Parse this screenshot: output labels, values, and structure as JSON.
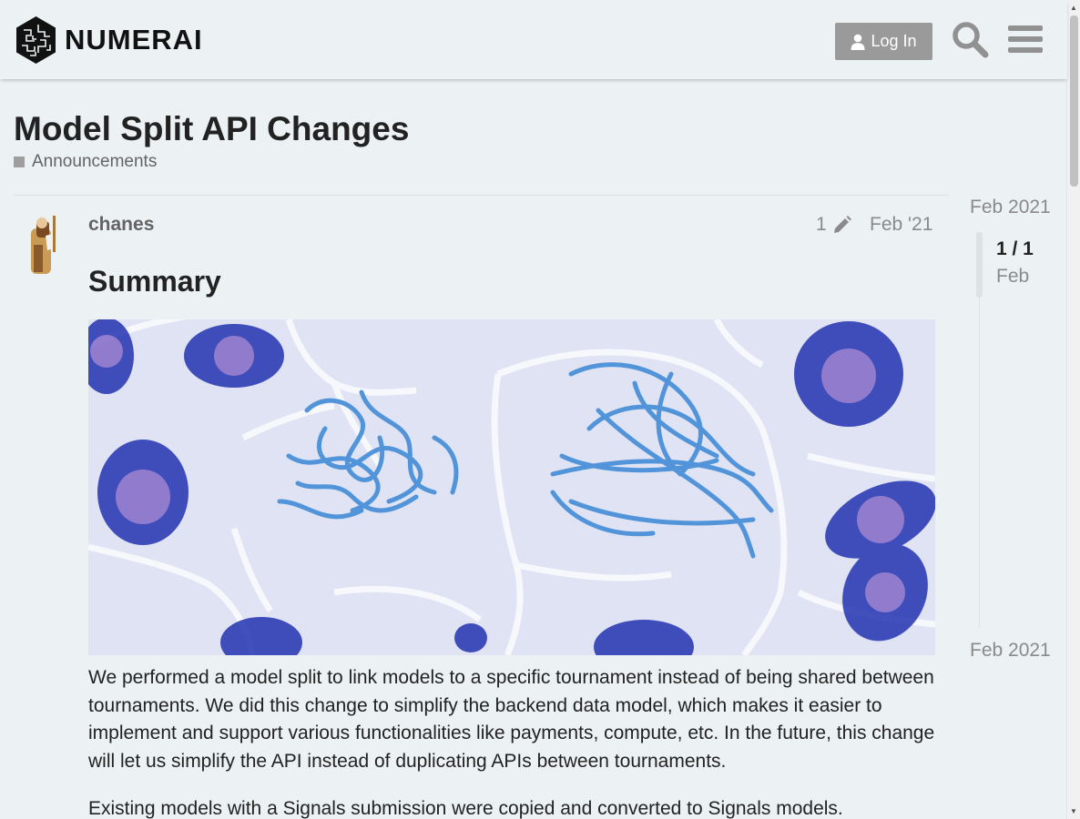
{
  "header": {
    "brand": "NUMERAI",
    "login_label": "Log In"
  },
  "topic": {
    "title": "Model Split API Changes",
    "category": "Announcements",
    "category_color": "#9e9e9e"
  },
  "post": {
    "username": "chanes",
    "edit_count": "1",
    "date": "Feb '21",
    "heading": "Summary",
    "paragraphs": [
      "We performed a model split to link models to a specific tournament instead of being shared between tournaments. We did this change to simplify the backend data model, which makes it easier to implement and support various functionalities like payments, compute, etc. In the future, this change will let us simplify the API instead of duplicating APIs between tournaments.",
      "Existing models with a Signals submission were copied and converted to Signals models."
    ]
  },
  "timeline": {
    "start_date": "Feb 2021",
    "position": "1 / 1",
    "month": "Feb",
    "end_date": "Feb 2021"
  },
  "icons": {
    "logo": "numerai-logo-icon",
    "user": "user-icon",
    "search": "search-icon",
    "menu": "hamburger-menu-icon",
    "edit": "pencil-icon"
  }
}
